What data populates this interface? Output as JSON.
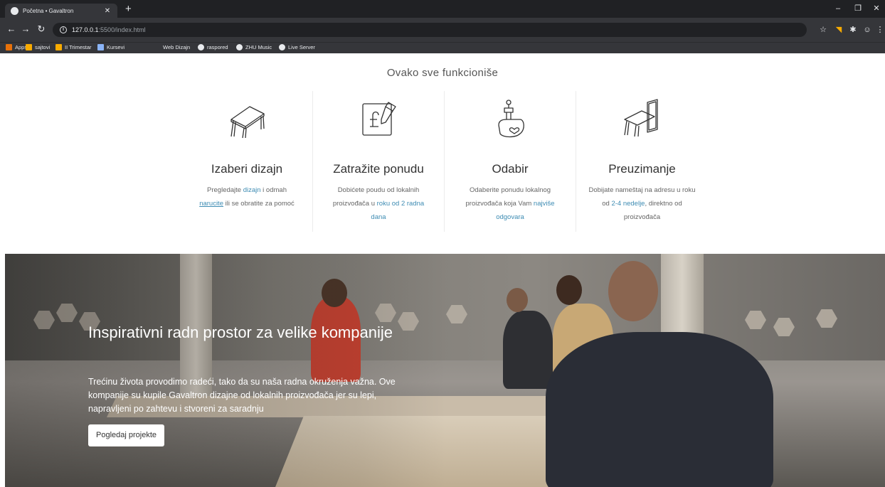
{
  "browser": {
    "tab_title": "Početna • Gavaltron",
    "url_host": "127.0.0.1",
    "url_path": ":5500/index.html",
    "bookmarks": [
      {
        "label": "Apps",
        "color": "#e8710a"
      },
      {
        "label": "sajtovi",
        "color": "#f9ab00"
      },
      {
        "label": "II Trimestar",
        "color": "#f9ab00"
      },
      {
        "label": "Kursevi",
        "color": "#8ab4f8"
      },
      {
        "label": "Web Dizajn",
        "color": "#35363a"
      },
      {
        "label": "raspored",
        "color": "#e8eaed"
      },
      {
        "label": "ZHU Music",
        "color": "#e8eaed"
      },
      {
        "label": "Live Server",
        "color": "#e8eaed"
      }
    ]
  },
  "page": {
    "section_title": "Ovako sve funkcioniše",
    "steps": [
      {
        "title": "Izaberi dizajn",
        "icon": "desk-icon",
        "line1_pre": "Pregledajte ",
        "line1_link": "dizajn",
        "line1_post": " i odmah",
        "line2_link": "narucite",
        "line2_post": " ili se obratite za pomoć"
      },
      {
        "title": "Zatražite ponudu",
        "icon": "quote-icon",
        "line1": "Dobićete poudu od lokalnih",
        "line2_pre": "proizvođača u ",
        "line2_link": "roku od 2 radna",
        "line3_link": "dana"
      },
      {
        "title": "Odabir",
        "icon": "maker-icon",
        "line1": "Odaberite ponudu lokalnog",
        "line2_pre": "proizvođača koja Vam ",
        "line2_link": "najviše",
        "line3_link": "odgovara"
      },
      {
        "title": "Preuzimanje",
        "icon": "delivery-icon",
        "line1": "Dobijate nameštaj na adresu u roku",
        "line2_pre": "od ",
        "line2_link": "2-4 nedelje",
        "line2_post": ", direktno od",
        "line3": "proizvođača"
      }
    ],
    "hero": {
      "title": "Inspirativni radn prostor za velike kompanije",
      "text": "Trećinu života provodimo radeći, tako da su naša radna okruženja važna. Ove kompanije su kupile Gavaltron dizajne od lokalnih proizvođača jer su lepi, napravljeni po zahtevu i stvoreni za saradnju",
      "button": "Pogledaj projekte"
    }
  },
  "colors": {
    "link": "#3e8cb3",
    "chrome_dark": "#202124",
    "chrome": "#35363a"
  }
}
